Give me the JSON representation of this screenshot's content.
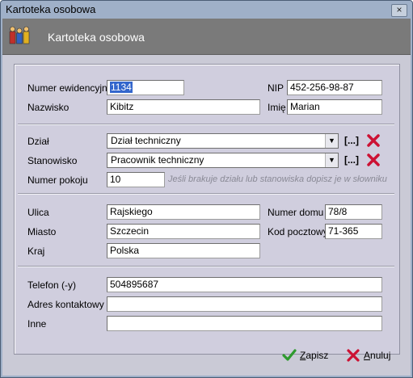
{
  "window": {
    "title": "Kartoteka osobowa",
    "close_glyph": "×"
  },
  "header": {
    "title": "Kartoteka osobowa",
    "icon": "people-figures-icon"
  },
  "fields": {
    "numer_ewidencyjny": {
      "label": "Numer ewidencyjny",
      "value": "1134"
    },
    "nip": {
      "label": "NIP",
      "value": "452-256-98-87"
    },
    "nazwisko": {
      "label": "Nazwisko",
      "value": "Kibitz"
    },
    "imie": {
      "label": "Imię",
      "value": "Marian"
    },
    "dzial": {
      "label": "Dział",
      "value": "Dział techniczny"
    },
    "stanowisko": {
      "label": "Stanowisko",
      "value": "Pracownik techniczny"
    },
    "numer_pokoju": {
      "label": "Numer pokoju",
      "value": "10"
    },
    "hint": "Jeśli brakuje działu lub stanowiska dopisz je w słowniku",
    "ulica": {
      "label": "Ulica",
      "value": "Rajskiego"
    },
    "numer_domu": {
      "label": "Numer domu",
      "value": "78/8"
    },
    "miasto": {
      "label": "Miasto",
      "value": "Szczecin"
    },
    "kod_pocztowy": {
      "label": "Kod pocztowy",
      "value": "71-365"
    },
    "kraj": {
      "label": "Kraj",
      "value": "Polska"
    },
    "telefon": {
      "label": "Telefon (-y)",
      "value": "504895687"
    },
    "adres_kontaktowy": {
      "label": "Adres kontaktowy",
      "value": ""
    },
    "inne": {
      "label": "Inne",
      "value": ""
    }
  },
  "picker_label": "[...]",
  "buttons": {
    "save": {
      "first": "Z",
      "rest": "apisz"
    },
    "cancel": {
      "first": "A",
      "rest": "nuluj"
    }
  },
  "colors": {
    "header_bg": "#7a7a7a",
    "panel_bg": "#d0cede",
    "delete_red": "#cc1133",
    "ok_green": "#2e9a2e"
  }
}
